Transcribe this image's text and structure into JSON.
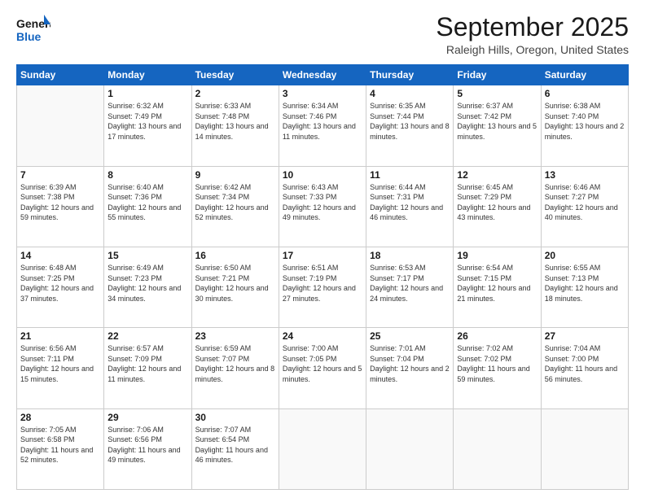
{
  "header": {
    "logo_line1": "General",
    "logo_line2": "Blue",
    "month_title": "September 2025",
    "location": "Raleigh Hills, Oregon, United States"
  },
  "days_of_week": [
    "Sunday",
    "Monday",
    "Tuesday",
    "Wednesday",
    "Thursday",
    "Friday",
    "Saturday"
  ],
  "weeks": [
    [
      {
        "num": "",
        "sunrise": "",
        "sunset": "",
        "daylight": ""
      },
      {
        "num": "1",
        "sunrise": "Sunrise: 6:32 AM",
        "sunset": "Sunset: 7:49 PM",
        "daylight": "Daylight: 13 hours and 17 minutes."
      },
      {
        "num": "2",
        "sunrise": "Sunrise: 6:33 AM",
        "sunset": "Sunset: 7:48 PM",
        "daylight": "Daylight: 13 hours and 14 minutes."
      },
      {
        "num": "3",
        "sunrise": "Sunrise: 6:34 AM",
        "sunset": "Sunset: 7:46 PM",
        "daylight": "Daylight: 13 hours and 11 minutes."
      },
      {
        "num": "4",
        "sunrise": "Sunrise: 6:35 AM",
        "sunset": "Sunset: 7:44 PM",
        "daylight": "Daylight: 13 hours and 8 minutes."
      },
      {
        "num": "5",
        "sunrise": "Sunrise: 6:37 AM",
        "sunset": "Sunset: 7:42 PM",
        "daylight": "Daylight: 13 hours and 5 minutes."
      },
      {
        "num": "6",
        "sunrise": "Sunrise: 6:38 AM",
        "sunset": "Sunset: 7:40 PM",
        "daylight": "Daylight: 13 hours and 2 minutes."
      }
    ],
    [
      {
        "num": "7",
        "sunrise": "Sunrise: 6:39 AM",
        "sunset": "Sunset: 7:38 PM",
        "daylight": "Daylight: 12 hours and 59 minutes."
      },
      {
        "num": "8",
        "sunrise": "Sunrise: 6:40 AM",
        "sunset": "Sunset: 7:36 PM",
        "daylight": "Daylight: 12 hours and 55 minutes."
      },
      {
        "num": "9",
        "sunrise": "Sunrise: 6:42 AM",
        "sunset": "Sunset: 7:34 PM",
        "daylight": "Daylight: 12 hours and 52 minutes."
      },
      {
        "num": "10",
        "sunrise": "Sunrise: 6:43 AM",
        "sunset": "Sunset: 7:33 PM",
        "daylight": "Daylight: 12 hours and 49 minutes."
      },
      {
        "num": "11",
        "sunrise": "Sunrise: 6:44 AM",
        "sunset": "Sunset: 7:31 PM",
        "daylight": "Daylight: 12 hours and 46 minutes."
      },
      {
        "num": "12",
        "sunrise": "Sunrise: 6:45 AM",
        "sunset": "Sunset: 7:29 PM",
        "daylight": "Daylight: 12 hours and 43 minutes."
      },
      {
        "num": "13",
        "sunrise": "Sunrise: 6:46 AM",
        "sunset": "Sunset: 7:27 PM",
        "daylight": "Daylight: 12 hours and 40 minutes."
      }
    ],
    [
      {
        "num": "14",
        "sunrise": "Sunrise: 6:48 AM",
        "sunset": "Sunset: 7:25 PM",
        "daylight": "Daylight: 12 hours and 37 minutes."
      },
      {
        "num": "15",
        "sunrise": "Sunrise: 6:49 AM",
        "sunset": "Sunset: 7:23 PM",
        "daylight": "Daylight: 12 hours and 34 minutes."
      },
      {
        "num": "16",
        "sunrise": "Sunrise: 6:50 AM",
        "sunset": "Sunset: 7:21 PM",
        "daylight": "Daylight: 12 hours and 30 minutes."
      },
      {
        "num": "17",
        "sunrise": "Sunrise: 6:51 AM",
        "sunset": "Sunset: 7:19 PM",
        "daylight": "Daylight: 12 hours and 27 minutes."
      },
      {
        "num": "18",
        "sunrise": "Sunrise: 6:53 AM",
        "sunset": "Sunset: 7:17 PM",
        "daylight": "Daylight: 12 hours and 24 minutes."
      },
      {
        "num": "19",
        "sunrise": "Sunrise: 6:54 AM",
        "sunset": "Sunset: 7:15 PM",
        "daylight": "Daylight: 12 hours and 21 minutes."
      },
      {
        "num": "20",
        "sunrise": "Sunrise: 6:55 AM",
        "sunset": "Sunset: 7:13 PM",
        "daylight": "Daylight: 12 hours and 18 minutes."
      }
    ],
    [
      {
        "num": "21",
        "sunrise": "Sunrise: 6:56 AM",
        "sunset": "Sunset: 7:11 PM",
        "daylight": "Daylight: 12 hours and 15 minutes."
      },
      {
        "num": "22",
        "sunrise": "Sunrise: 6:57 AM",
        "sunset": "Sunset: 7:09 PM",
        "daylight": "Daylight: 12 hours and 11 minutes."
      },
      {
        "num": "23",
        "sunrise": "Sunrise: 6:59 AM",
        "sunset": "Sunset: 7:07 PM",
        "daylight": "Daylight: 12 hours and 8 minutes."
      },
      {
        "num": "24",
        "sunrise": "Sunrise: 7:00 AM",
        "sunset": "Sunset: 7:05 PM",
        "daylight": "Daylight: 12 hours and 5 minutes."
      },
      {
        "num": "25",
        "sunrise": "Sunrise: 7:01 AM",
        "sunset": "Sunset: 7:04 PM",
        "daylight": "Daylight: 12 hours and 2 minutes."
      },
      {
        "num": "26",
        "sunrise": "Sunrise: 7:02 AM",
        "sunset": "Sunset: 7:02 PM",
        "daylight": "Daylight: 11 hours and 59 minutes."
      },
      {
        "num": "27",
        "sunrise": "Sunrise: 7:04 AM",
        "sunset": "Sunset: 7:00 PM",
        "daylight": "Daylight: 11 hours and 56 minutes."
      }
    ],
    [
      {
        "num": "28",
        "sunrise": "Sunrise: 7:05 AM",
        "sunset": "Sunset: 6:58 PM",
        "daylight": "Daylight: 11 hours and 52 minutes."
      },
      {
        "num": "29",
        "sunrise": "Sunrise: 7:06 AM",
        "sunset": "Sunset: 6:56 PM",
        "daylight": "Daylight: 11 hours and 49 minutes."
      },
      {
        "num": "30",
        "sunrise": "Sunrise: 7:07 AM",
        "sunset": "Sunset: 6:54 PM",
        "daylight": "Daylight: 11 hours and 46 minutes."
      },
      {
        "num": "",
        "sunrise": "",
        "sunset": "",
        "daylight": ""
      },
      {
        "num": "",
        "sunrise": "",
        "sunset": "",
        "daylight": ""
      },
      {
        "num": "",
        "sunrise": "",
        "sunset": "",
        "daylight": ""
      },
      {
        "num": "",
        "sunrise": "",
        "sunset": "",
        "daylight": ""
      }
    ]
  ]
}
